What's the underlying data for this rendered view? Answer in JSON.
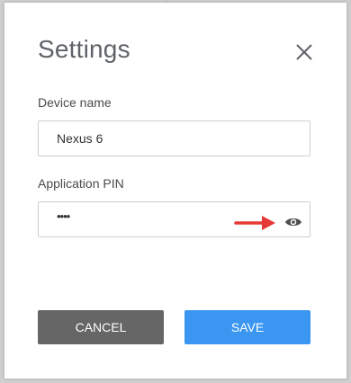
{
  "dialog": {
    "title": "Settings",
    "close_icon": "close-icon",
    "device_name": {
      "label": "Device name",
      "value": "Nexus 6"
    },
    "application_pin": {
      "label": "Application PIN",
      "masked_value": "••••",
      "visibility_icon": "eye-icon"
    },
    "annotation": {
      "icon": "red-arrow-icon",
      "color": "#e53935"
    },
    "buttons": {
      "cancel_label": "CANCEL",
      "save_label": "SAVE"
    },
    "colors": {
      "cancel": "#666666",
      "save": "#3a96f0"
    }
  }
}
